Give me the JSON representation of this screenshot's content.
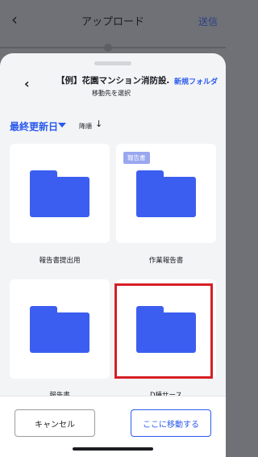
{
  "topbar": {
    "back_icon": "chevron-left-icon",
    "title": "アップロード",
    "send": "送信"
  },
  "sheet": {
    "title": "【例】花園マンション消防設…",
    "subtitle": "移動先を選択",
    "new_folder": "新規フォルダ"
  },
  "sort": {
    "label": "最終更新日",
    "order": "降順",
    "order_icon": "sort-direction-icon"
  },
  "folders": [
    {
      "name": "報告書提出用",
      "tag": ""
    },
    {
      "name": "作業報告書",
      "tag": "報告書"
    },
    {
      "name": "報告書",
      "tag": ""
    },
    {
      "name": "D棟サース",
      "tag": ""
    }
  ],
  "footer": {
    "cancel": "キャンセル",
    "move": "ここに移動する"
  },
  "colors": {
    "accent": "#2b5aec",
    "folder": "#3c5ef0",
    "highlight": "#d61f26"
  }
}
